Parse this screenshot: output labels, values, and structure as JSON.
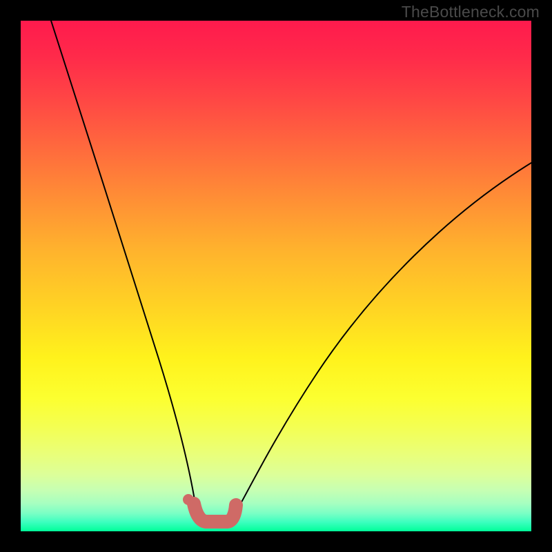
{
  "watermark": "TheBottleneck.com",
  "colors": {
    "frame_background": "#000000",
    "watermark_text": "#4a4a4a",
    "curve_stroke": "#000000",
    "trough_stroke": "#cf6a66",
    "gradient_top": "#ff1a4d",
    "gradient_mid": "#fff21c",
    "gradient_bottom": "#00ff99"
  },
  "chart_data": {
    "type": "line",
    "title": "",
    "xlabel": "",
    "ylabel": "",
    "xlim": [
      0,
      100
    ],
    "ylim": [
      0,
      100
    ],
    "grid": false,
    "legend": false,
    "series": [
      {
        "name": "left_branch",
        "x": [
          6.0,
          10.0,
          14.0,
          18.0,
          22.0,
          25.0,
          28.0,
          30.0,
          31.5,
          33.0,
          34.0
        ],
        "y": [
          100.0,
          84.0,
          67.0,
          51.0,
          36.0,
          25.0,
          15.0,
          9.0,
          6.0,
          4.0,
          3.0
        ]
      },
      {
        "name": "trough",
        "x": [
          34.0,
          36.0,
          38.0,
          40.0,
          42.0
        ],
        "y": [
          3.0,
          2.0,
          2.0,
          2.0,
          3.0
        ]
      },
      {
        "name": "right_branch",
        "x": [
          42.0,
          46.0,
          52.0,
          60.0,
          70.0,
          80.0,
          90.0,
          100.0
        ],
        "y": [
          3.0,
          7.0,
          15.0,
          27.0,
          41.0,
          53.0,
          63.0,
          72.0
        ]
      }
    ],
    "annotations": [
      {
        "name": "trough_marker_left_dot",
        "x": 32.5,
        "y": 4.5
      }
    ]
  }
}
